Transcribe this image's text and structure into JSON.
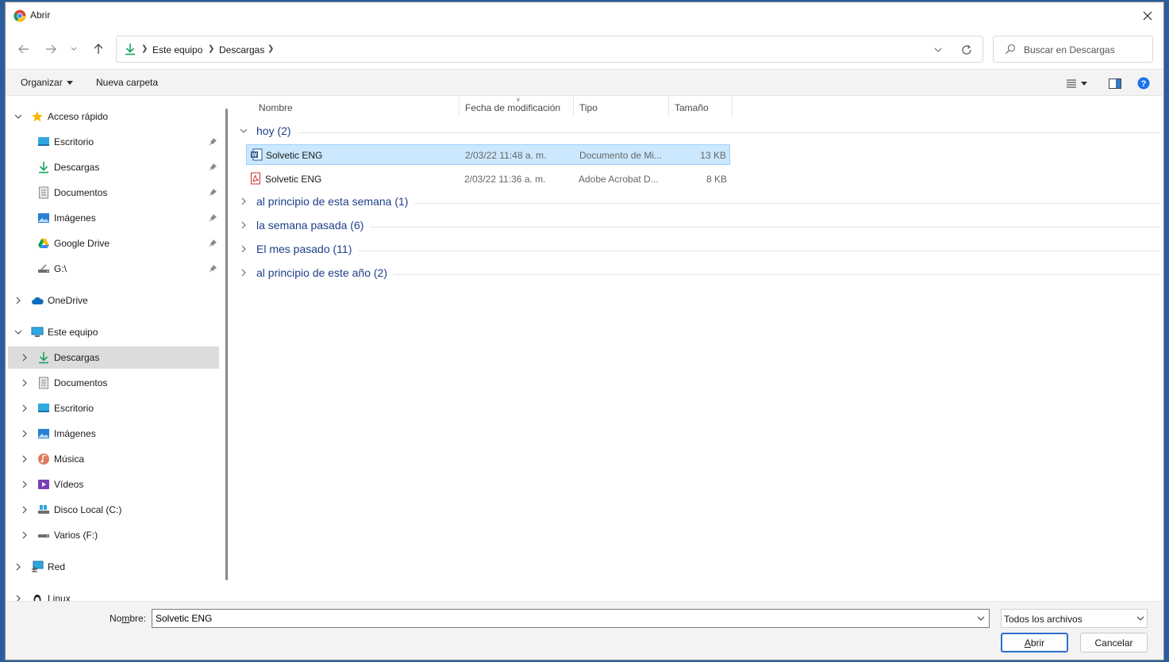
{
  "window": {
    "title": "Abrir"
  },
  "address": {
    "crumbs": [
      "Este equipo",
      "Descargas"
    ]
  },
  "search": {
    "placeholder": "Buscar en Descargas"
  },
  "toolbar": {
    "organize_label": "Organizar",
    "new_folder_label": "Nueva carpeta"
  },
  "sidebar": {
    "quick_access": {
      "label": "Acceso rápido"
    },
    "quick_items": [
      {
        "label": "Escritorio",
        "icon": "desktop-icon"
      },
      {
        "label": "Descargas",
        "icon": "download-icon"
      },
      {
        "label": "Documentos",
        "icon": "document-icon"
      },
      {
        "label": "Imágenes",
        "icon": "pictures-icon"
      },
      {
        "label": "Google Drive",
        "icon": "google-drive-icon"
      },
      {
        "label": "G:\\",
        "icon": "drive-icon"
      }
    ],
    "onedrive": {
      "label": "OneDrive"
    },
    "this_pc": {
      "label": "Este equipo"
    },
    "pc_items": [
      {
        "label": "Descargas",
        "icon": "download-icon"
      },
      {
        "label": "Documentos",
        "icon": "document-icon"
      },
      {
        "label": "Escritorio",
        "icon": "desktop-icon"
      },
      {
        "label": "Imágenes",
        "icon": "pictures-icon"
      },
      {
        "label": "Música",
        "icon": "music-icon"
      },
      {
        "label": "Vídeos",
        "icon": "videos-icon"
      },
      {
        "label": "Disco Local (C:)",
        "icon": "local-disk-icon"
      },
      {
        "label": "Varios (F:)",
        "icon": "drive-icon"
      }
    ],
    "network": {
      "label": "Red"
    },
    "linux": {
      "label": "Linux"
    }
  },
  "columns": {
    "name": "Nombre",
    "date": "Fecha de modificación",
    "type": "Tipo",
    "size": "Tamaño"
  },
  "groups": [
    {
      "label": "hoy (2)",
      "expanded": true
    },
    {
      "label": "al principio de esta semana (1)",
      "expanded": false
    },
    {
      "label": "la semana pasada (6)",
      "expanded": false
    },
    {
      "label": "El mes pasado (11)",
      "expanded": false
    },
    {
      "label": "al principio de este año (2)",
      "expanded": false
    }
  ],
  "files": [
    {
      "name": "Solvetic ENG",
      "date": "2/03/22 11:48 a. m.",
      "type": "Documento de Mi...",
      "size": "13 KB",
      "icon": "word-doc-icon",
      "selected": true
    },
    {
      "name": "Solvetic ENG",
      "date": "2/03/22 11:36 a. m.",
      "type": "Adobe Acrobat D...",
      "size": "8 KB",
      "icon": "pdf-icon",
      "selected": false
    }
  ],
  "footer": {
    "name_label_pre": "No",
    "name_label_ul": "m",
    "name_label_post": "bre:",
    "name_value": "Solvetic ENG",
    "filter_value": "Todos los archivos",
    "open_ul": "A",
    "open_rest": "brir",
    "cancel_label": "Cancelar"
  },
  "colors": {
    "accent": "#2c6ecf",
    "selection_bg": "#cce8ff",
    "group_text": "#1e3f8a"
  }
}
